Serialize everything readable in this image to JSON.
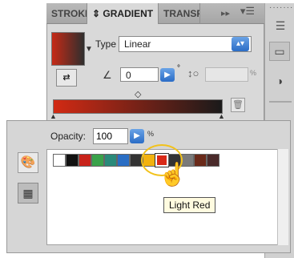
{
  "tabs": {
    "stroke": "STROKE",
    "gradient": "GRADIENT",
    "transparency": "TRANSPARENCY"
  },
  "gradient": {
    "type_label": "Type",
    "type_value": "Linear",
    "angle_value": "0",
    "degree_symbol": "°",
    "percent_symbol": "%"
  },
  "swatches_panel": {
    "opacity_label": "Opacity:",
    "opacity_value": "100",
    "percent_symbol": "%",
    "tooltip": "Light Red",
    "swatches": [
      {
        "name": "white",
        "color": "#ffffff"
      },
      {
        "name": "black",
        "color": "#111111"
      },
      {
        "name": "red",
        "color": "#c8231a"
      },
      {
        "name": "green",
        "color": "#3aa24a"
      },
      {
        "name": "teal",
        "color": "#2a8a7a"
      },
      {
        "name": "blue",
        "color": "#2a6ec4"
      },
      {
        "name": "dark",
        "color": "#333333"
      },
      {
        "name": "yellow-orange",
        "color": "#f2b20f"
      },
      {
        "name": "light-red",
        "color": "#d92a18"
      },
      {
        "name": "dark-gray",
        "color": "#333333"
      },
      {
        "name": "gray",
        "color": "#7a7a7a"
      },
      {
        "name": "maroon",
        "color": "#6a2a1a"
      },
      {
        "name": "dark-maroon",
        "color": "#4a2a2a"
      }
    ]
  }
}
